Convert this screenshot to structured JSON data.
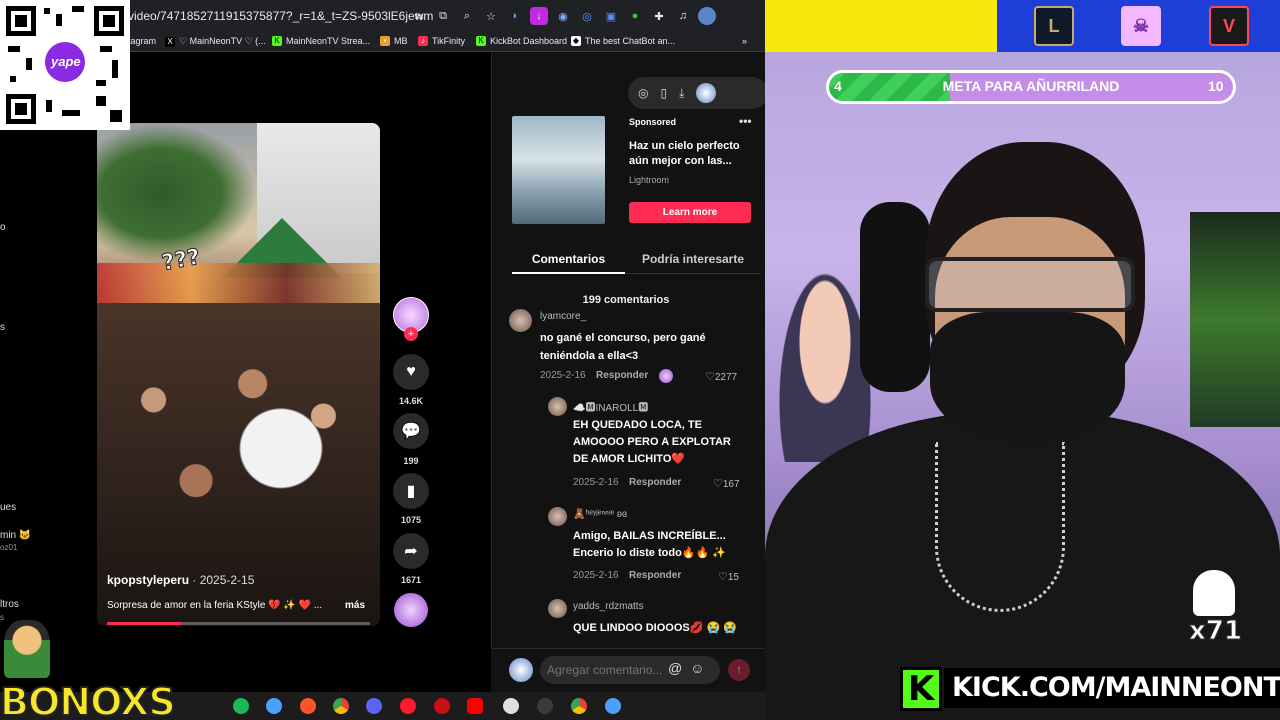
{
  "browser": {
    "url": "video/7471852711915375877?_r=1&_t=ZS-9503lE6jewm",
    "bookmarks": [
      {
        "label": "tagram"
      },
      {
        "label": "♡ MainNeonTV ♡ (..."
      },
      {
        "label": "MainNeonTV Strea..."
      },
      {
        "label": "MB"
      },
      {
        "label": "TikFinity"
      },
      {
        "label": "KickBot Dashboard"
      },
      {
        "label": "The best ChatBot an..."
      }
    ],
    "overflow": "»"
  },
  "qr": {
    "brand": "yape"
  },
  "leftnav": {
    "fragments": [
      "o",
      "s",
      "ues",
      "min 🐱",
      "oz01",
      "ltros",
      "s"
    ]
  },
  "video": {
    "overlay_text": "???",
    "author": "kpopstyleperu",
    "date": " · 2025-2-15",
    "caption": "Sorpresa de amor en la feria KStyle 💔 ✨ ❤️ ...",
    "more": "más",
    "progress": 0.28
  },
  "actions": {
    "likes": "14.6K",
    "comments": "199",
    "saves": "1075",
    "shares": "1671"
  },
  "ad": {
    "sponsored": "Sponsored",
    "title": "Haz un cielo perfecto aún mejor con las...",
    "brand": "Lightroom",
    "cta": "Learn more",
    "menu": "•••"
  },
  "tabs": {
    "comments": "Comentarios",
    "related": "Podría interesarte"
  },
  "comments_header": "199 comentarios",
  "comments": [
    {
      "user": "lyamcore_",
      "lines": [
        "no gané el concurso, pero gané",
        "teniéndola a ella<3"
      ],
      "date": "2025-2-16",
      "reply": "Responder",
      "likes": "2277"
    },
    {
      "user": "☁️🅼INAROLL🅼",
      "lines": [
        "EH QUEDADO LOCA, TE",
        "AMOOOO PERO A EXPLOTAR",
        "DE AMOR LICHITO❤️"
      ],
      "date": "2025-2-16",
      "reply": "Responder",
      "likes": "167"
    },
    {
      "user": "🧸ʰᵉʸʲᵉⁿⁿᶦᵉ ʚɞ",
      "lines": [
        "Amigo, BAILAS INCREÍBLE...",
        "Encerio lo diste todo🔥🔥 ✨"
      ],
      "date": "2025-2-16",
      "reply": "Responder",
      "likes": "15"
    },
    {
      "user": "yadds_rdzmatts",
      "lines": [
        "QUE LINDOO DIOOOS💋 😭 😭"
      ],
      "date": "",
      "reply": "",
      "likes": ""
    }
  ],
  "comment_input": {
    "placeholder": "Agregar comentario..."
  },
  "taskbar": {
    "logo_text": "BONOXS"
  },
  "stream": {
    "goal_label": "META PARA AÑURRILAND",
    "goal_start": "4",
    "goal_end": "10",
    "goal_progress": 0.3,
    "badge": "x71",
    "kick_url": "KICK.COM/MAINNEONTV",
    "kick_letter": "K"
  },
  "colors": {
    "tiktok_red": "#fe2c55",
    "kick_green": "#53fc18",
    "overlay_yellow": "#f7e80d",
    "overlay_blue": "#1e3ed8"
  }
}
